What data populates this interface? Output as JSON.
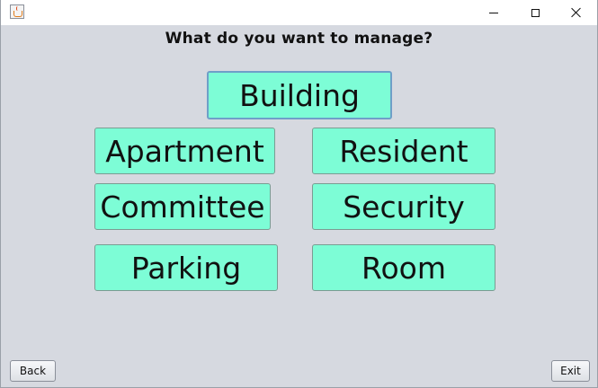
{
  "window": {
    "icon": "java-cup-icon",
    "controls": {
      "minimize": "minimize-icon",
      "maximize": "maximize-icon",
      "close": "close-icon"
    }
  },
  "heading": "What do you want to manage?",
  "buttons": {
    "building": "Building",
    "apartment": "Apartment",
    "resident": "Resident",
    "committee": "Committee",
    "security": "Security",
    "parking": "Parking",
    "room": "Room"
  },
  "footer": {
    "back": "Back",
    "exit": "Exit"
  },
  "colors": {
    "button_bg": "#7dfdd6",
    "window_bg": "#d6d9e0",
    "focus_border": "#6f9fc8"
  }
}
